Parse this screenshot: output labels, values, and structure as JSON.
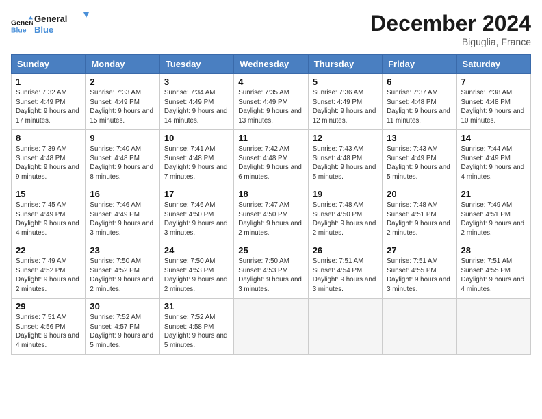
{
  "header": {
    "logo_line1": "General",
    "logo_line2": "Blue",
    "month": "December 2024",
    "location": "Biguglia, France"
  },
  "weekdays": [
    "Sunday",
    "Monday",
    "Tuesday",
    "Wednesday",
    "Thursday",
    "Friday",
    "Saturday"
  ],
  "weeks": [
    [
      {
        "day": 1,
        "info": "Sunrise: 7:32 AM\nSunset: 4:49 PM\nDaylight: 9 hours\nand 17 minutes."
      },
      {
        "day": 2,
        "info": "Sunrise: 7:33 AM\nSunset: 4:49 PM\nDaylight: 9 hours\nand 15 minutes."
      },
      {
        "day": 3,
        "info": "Sunrise: 7:34 AM\nSunset: 4:49 PM\nDaylight: 9 hours\nand 14 minutes."
      },
      {
        "day": 4,
        "info": "Sunrise: 7:35 AM\nSunset: 4:49 PM\nDaylight: 9 hours\nand 13 minutes."
      },
      {
        "day": 5,
        "info": "Sunrise: 7:36 AM\nSunset: 4:49 PM\nDaylight: 9 hours\nand 12 minutes."
      },
      {
        "day": 6,
        "info": "Sunrise: 7:37 AM\nSunset: 4:48 PM\nDaylight: 9 hours\nand 11 minutes."
      },
      {
        "day": 7,
        "info": "Sunrise: 7:38 AM\nSunset: 4:48 PM\nDaylight: 9 hours\nand 10 minutes."
      }
    ],
    [
      {
        "day": 8,
        "info": "Sunrise: 7:39 AM\nSunset: 4:48 PM\nDaylight: 9 hours\nand 9 minutes."
      },
      {
        "day": 9,
        "info": "Sunrise: 7:40 AM\nSunset: 4:48 PM\nDaylight: 9 hours\nand 8 minutes."
      },
      {
        "day": 10,
        "info": "Sunrise: 7:41 AM\nSunset: 4:48 PM\nDaylight: 9 hours\nand 7 minutes."
      },
      {
        "day": 11,
        "info": "Sunrise: 7:42 AM\nSunset: 4:48 PM\nDaylight: 9 hours\nand 6 minutes."
      },
      {
        "day": 12,
        "info": "Sunrise: 7:43 AM\nSunset: 4:48 PM\nDaylight: 9 hours\nand 5 minutes."
      },
      {
        "day": 13,
        "info": "Sunrise: 7:43 AM\nSunset: 4:49 PM\nDaylight: 9 hours\nand 5 minutes."
      },
      {
        "day": 14,
        "info": "Sunrise: 7:44 AM\nSunset: 4:49 PM\nDaylight: 9 hours\nand 4 minutes."
      }
    ],
    [
      {
        "day": 15,
        "info": "Sunrise: 7:45 AM\nSunset: 4:49 PM\nDaylight: 9 hours\nand 4 minutes."
      },
      {
        "day": 16,
        "info": "Sunrise: 7:46 AM\nSunset: 4:49 PM\nDaylight: 9 hours\nand 3 minutes."
      },
      {
        "day": 17,
        "info": "Sunrise: 7:46 AM\nSunset: 4:50 PM\nDaylight: 9 hours\nand 3 minutes."
      },
      {
        "day": 18,
        "info": "Sunrise: 7:47 AM\nSunset: 4:50 PM\nDaylight: 9 hours\nand 2 minutes."
      },
      {
        "day": 19,
        "info": "Sunrise: 7:48 AM\nSunset: 4:50 PM\nDaylight: 9 hours\nand 2 minutes."
      },
      {
        "day": 20,
        "info": "Sunrise: 7:48 AM\nSunset: 4:51 PM\nDaylight: 9 hours\nand 2 minutes."
      },
      {
        "day": 21,
        "info": "Sunrise: 7:49 AM\nSunset: 4:51 PM\nDaylight: 9 hours\nand 2 minutes."
      }
    ],
    [
      {
        "day": 22,
        "info": "Sunrise: 7:49 AM\nSunset: 4:52 PM\nDaylight: 9 hours\nand 2 minutes."
      },
      {
        "day": 23,
        "info": "Sunrise: 7:50 AM\nSunset: 4:52 PM\nDaylight: 9 hours\nand 2 minutes."
      },
      {
        "day": 24,
        "info": "Sunrise: 7:50 AM\nSunset: 4:53 PM\nDaylight: 9 hours\nand 2 minutes."
      },
      {
        "day": 25,
        "info": "Sunrise: 7:50 AM\nSunset: 4:53 PM\nDaylight: 9 hours\nand 3 minutes."
      },
      {
        "day": 26,
        "info": "Sunrise: 7:51 AM\nSunset: 4:54 PM\nDaylight: 9 hours\nand 3 minutes."
      },
      {
        "day": 27,
        "info": "Sunrise: 7:51 AM\nSunset: 4:55 PM\nDaylight: 9 hours\nand 3 minutes."
      },
      {
        "day": 28,
        "info": "Sunrise: 7:51 AM\nSunset: 4:55 PM\nDaylight: 9 hours\nand 4 minutes."
      }
    ],
    [
      {
        "day": 29,
        "info": "Sunrise: 7:51 AM\nSunset: 4:56 PM\nDaylight: 9 hours\nand 4 minutes."
      },
      {
        "day": 30,
        "info": "Sunrise: 7:52 AM\nSunset: 4:57 PM\nDaylight: 9 hours\nand 5 minutes."
      },
      {
        "day": 31,
        "info": "Sunrise: 7:52 AM\nSunset: 4:58 PM\nDaylight: 9 hours\nand 5 minutes."
      },
      null,
      null,
      null,
      null
    ]
  ]
}
